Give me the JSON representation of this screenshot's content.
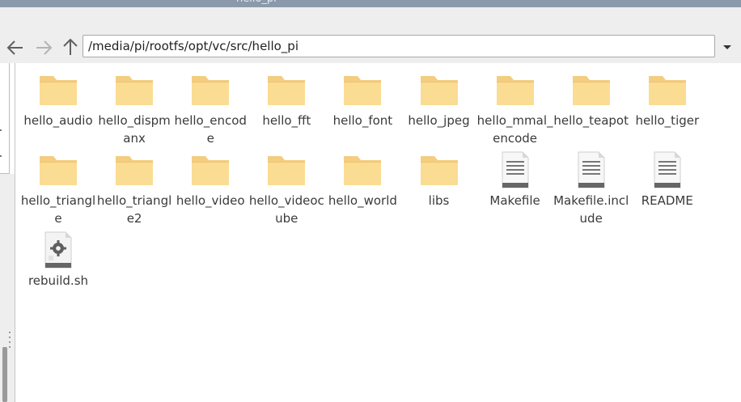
{
  "window": {
    "title": "hello_pi"
  },
  "toolbar": {
    "path_value": "/media/pi/rootfs/opt/vc/src/hello_pi",
    "back_icon": "arrow-left-icon",
    "forward_icon": "arrow-right-icon",
    "up_icon": "arrow-up-icon",
    "history_icon": "caret-down-icon"
  },
  "files": [
    {
      "name": "hello_audio",
      "kind": "folder"
    },
    {
      "name": "hello_dispmanx",
      "kind": "folder"
    },
    {
      "name": "hello_encode",
      "kind": "folder"
    },
    {
      "name": "hello_fft",
      "kind": "folder"
    },
    {
      "name": "hello_font",
      "kind": "folder"
    },
    {
      "name": "hello_jpeg",
      "kind": "folder"
    },
    {
      "name": "hello_mmal_encode",
      "kind": "folder"
    },
    {
      "name": "hello_teapot",
      "kind": "folder"
    },
    {
      "name": "hello_tiger",
      "kind": "folder"
    },
    {
      "name": "hello_triangle",
      "kind": "folder"
    },
    {
      "name": "hello_triangle2",
      "kind": "folder"
    },
    {
      "name": "hello_video",
      "kind": "folder"
    },
    {
      "name": "hello_videocube",
      "kind": "folder"
    },
    {
      "name": "hello_world",
      "kind": "folder"
    },
    {
      "name": "libs",
      "kind": "folder"
    },
    {
      "name": "Makefile",
      "kind": "text"
    },
    {
      "name": "Makefile.include",
      "kind": "text"
    },
    {
      "name": "README",
      "kind": "text"
    },
    {
      "name": "rebuild.sh",
      "kind": "script"
    }
  ],
  "colors": {
    "folder_body": "#fbdc93",
    "folder_tab": "#f3cd80",
    "titlebar": "#8a9aab",
    "toolbar": "#eeeeee",
    "doc_band": "#666666"
  }
}
